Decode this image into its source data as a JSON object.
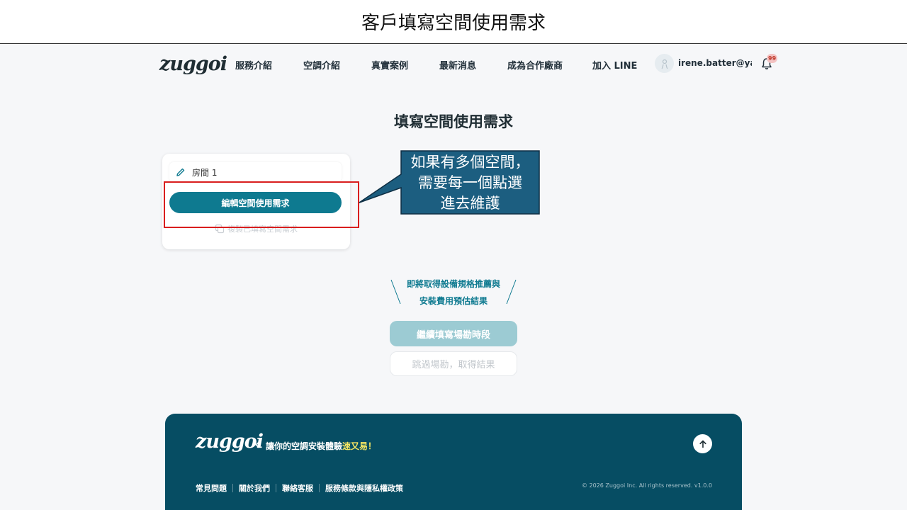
{
  "slide": {
    "title": "客戶填寫空間使用需求"
  },
  "nav": {
    "logo": "zuggoi",
    "items": [
      "服務介紹",
      "空調介紹",
      "真實案例",
      "最新消息",
      "成為合作廠商",
      "加入 LINE"
    ],
    "user_email": "irene.batter@yah···",
    "notification_count": "99"
  },
  "page": {
    "heading": "填寫空間使用需求"
  },
  "room_card": {
    "room_label": "房間 1",
    "edit_button": "編輯空間使用需求",
    "copy_label": "複製已填寫空間需求"
  },
  "callout": {
    "lines": [
      "如果有多個空間，",
      "需要每一個點選",
      "進去維護"
    ],
    "fill_color": "#1c5e80",
    "border_color": "#0f2f44",
    "highlight_color": "#d91e1e"
  },
  "result_teaser": {
    "line1": "即將取得設備規格推薦與",
    "line2": "安裝費用預估結果"
  },
  "buttons": {
    "continue": "繼續填寫場勘時段",
    "skip": "跳過場勘，取得結果"
  },
  "footer": {
    "logo": "zuggoi",
    "slogan_prefix": "讓你的空調安裝體驗",
    "slogan_highlight": "速又易！",
    "links": [
      "常見問題",
      "關於我們",
      "聯絡客服",
      "服務條款與隱私權政策"
    ],
    "copyright": "© 2026 Zuggoi Inc. All rights reserved. v1.0.0"
  },
  "colors": {
    "primary": "#0e7a90",
    "footer_bg": "#064d63",
    "disabled_button": "#9ccbd3",
    "slogan_highlight": "#f5e663"
  }
}
